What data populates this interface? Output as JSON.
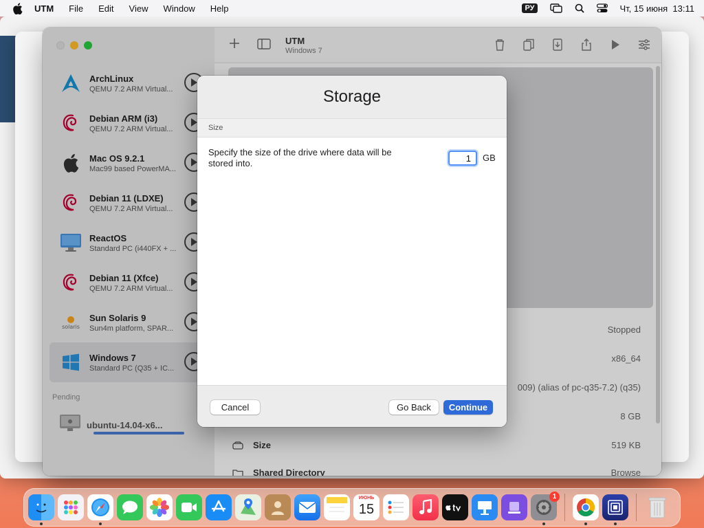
{
  "menubar": {
    "app_name": "UTM",
    "items": [
      "File",
      "Edit",
      "View",
      "Window",
      "Help"
    ],
    "keyboard_layout": "РУ",
    "clock": "Чт, 15 июня  13:11"
  },
  "utm": {
    "toolbar": {
      "title": "UTM",
      "subtitle": "Windows 7"
    },
    "vms": [
      {
        "name": "ArchLinux",
        "subtitle": "QEMU 7.2 ARM Virtual...",
        "icon": "archlinux-icon"
      },
      {
        "name": "Debian ARM (i3)",
        "subtitle": "QEMU 7.2 ARM Virtual...",
        "icon": "debian-icon"
      },
      {
        "name": "Mac OS 9.2.1",
        "subtitle": "Mac99 based PowerMA...",
        "icon": "apple-icon"
      },
      {
        "name": "Debian 11 (LDXE)",
        "subtitle": "QEMU 7.2 ARM Virtual...",
        "icon": "debian-icon"
      },
      {
        "name": "ReactOS",
        "subtitle": "Standard PC (i440FX + ...",
        "icon": "monitor-icon"
      },
      {
        "name": "Debian 11 (Xfce)",
        "subtitle": "QEMU 7.2 ARM Virtual...",
        "icon": "debian-icon"
      },
      {
        "name": "Sun Solaris 9",
        "subtitle": "Sun4m platform, SPAR...",
        "icon": "solaris-icon"
      },
      {
        "name": "Windows 7",
        "subtitle": "Standard PC (Q35 + IC...",
        "icon": "windows-icon"
      }
    ],
    "selected_index": 7,
    "pending_label": "Pending",
    "pending_item": {
      "name": "ubuntu-14.04-x6...",
      "progress": 1.0
    },
    "info": {
      "status": "Stopped",
      "architecture": "x86_64",
      "machine": "009) (alias of pc-q35-7.2) (q35)",
      "memory": "8 GB",
      "size_label": "Size",
      "size_value": "519 KB",
      "shared_dir_label": "Shared Directory",
      "shared_dir_value": "Browse"
    }
  },
  "sheet": {
    "title": "Storage",
    "section": "Size",
    "description": "Specify the size of the drive where data will be stored into.",
    "size_value": "1",
    "size_unit": "GB",
    "cancel": "Cancel",
    "go_back": "Go Back",
    "continue": "Continue"
  },
  "dock": {
    "calendar_month": "ИЮНЬ",
    "calendar_day": "15",
    "settings_badge": "1",
    "colors": {
      "accent": "#2f6bd8",
      "badge": "#ff3b30"
    }
  }
}
